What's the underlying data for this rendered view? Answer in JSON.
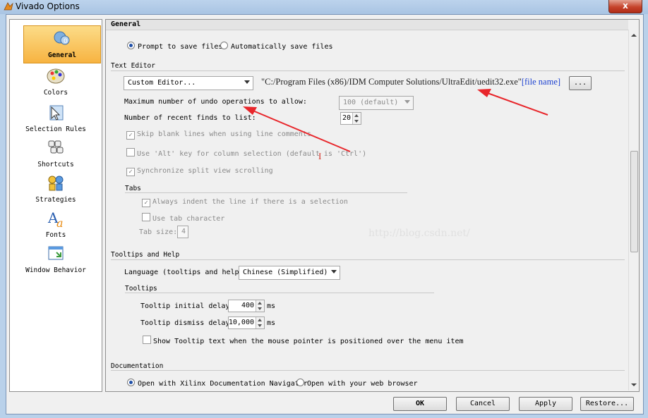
{
  "window": {
    "title": "Vivado Options",
    "close": "x"
  },
  "sidebar": {
    "items": [
      {
        "label": "General",
        "icon": "general-icon",
        "selected": true
      },
      {
        "label": "Colors",
        "icon": "palette-icon"
      },
      {
        "label": "Selection Rules",
        "icon": "cursor-icon"
      },
      {
        "label": "Shortcuts",
        "icon": "keyboard-icon"
      },
      {
        "label": "Strategies",
        "icon": "strategies-icon"
      },
      {
        "label": "Fonts",
        "icon": "font-icon"
      },
      {
        "label": "Window Behavior",
        "icon": "window-icon"
      }
    ]
  },
  "content": {
    "header": "General",
    "save": {
      "prompt": "Prompt to save files",
      "auto": "Automatically save files"
    },
    "text_editor": {
      "section": "Text Editor",
      "editor_select": "Custom Editor...",
      "editor_path": "\"C:/Program Files (x86)/IDM Computer Solutions/UltraEdit/uedit32.exe\"",
      "file_name": "[file name]",
      "browse": "...",
      "undo_label": "Maximum number of undo operations to allow:",
      "undo_value": "100 (default)",
      "recent_label": "Number of recent finds to list:",
      "recent_value": "20",
      "skip_blank": "Skip blank lines when using line comments",
      "use_alt": "Use 'Alt' key for column selection (default is 'Ctrl')",
      "sync_split": "Synchronize split view scrolling",
      "tabs_section": "Tabs",
      "always_indent": "Always indent the line if there is a selection",
      "use_tab": "Use tab character",
      "tab_size_label": "Tab size:",
      "tab_size_value": "4"
    },
    "tooltips": {
      "section": "Tooltips and Help",
      "language_label": "Language (tooltips and help):",
      "language_value": "Chinese (Simplified)",
      "sub_section": "Tooltips",
      "initial_label": "Tooltip initial delay:",
      "initial_value": "400",
      "dismiss_label": "Tooltip dismiss delay:",
      "dismiss_value": "10,000",
      "unit": "ms",
      "show_text": "Show Tooltip text when the mouse pointer is positioned over the menu item"
    },
    "documentation": {
      "section": "Documentation",
      "navigator": "Open with Xilinx Documentation Navigator",
      "browser": "Open with your web browser"
    },
    "watermark": "http://blog.csdn.net/",
    "cursor_mark": "I"
  },
  "buttons": {
    "ok": "OK",
    "cancel": "Cancel",
    "apply": "Apply",
    "restore": "Restore..."
  },
  "colors": {
    "accent_red": "#e8262b",
    "selected_bg": "#f7b341",
    "link_blue": "#1a3fd0"
  }
}
